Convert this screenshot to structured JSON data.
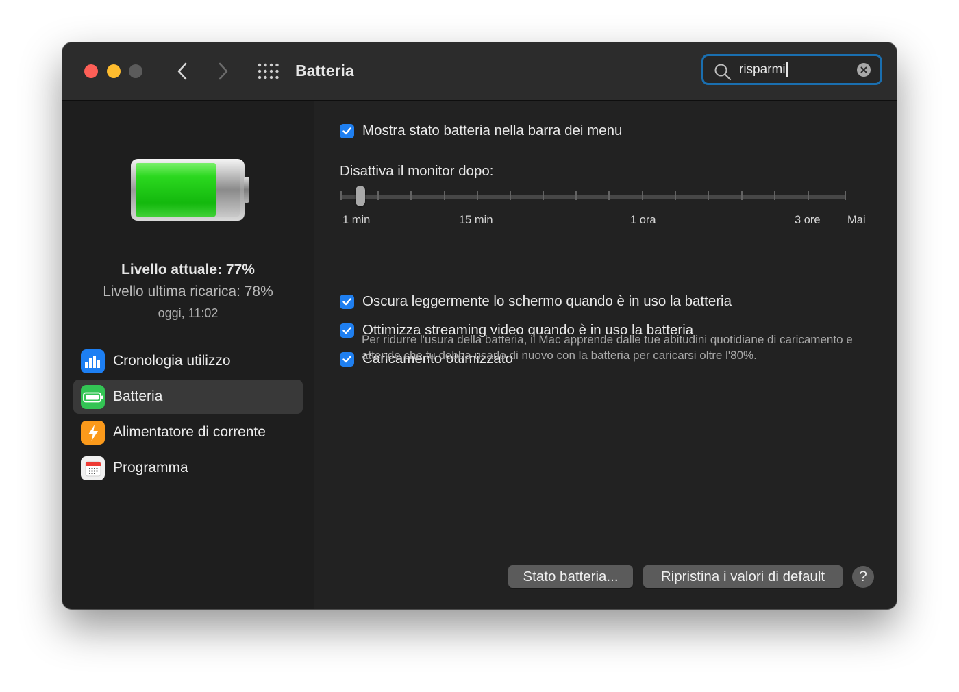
{
  "window": {
    "title": "Batteria"
  },
  "search": {
    "value": "risparmi"
  },
  "sidebar": {
    "level_now": "Livello attuale: 77%",
    "level_last": "Livello ultima ricarica: 78%",
    "level_time": "oggi, 11:02",
    "battery_level": 0.77,
    "items": [
      {
        "label": "Cronologia utilizzo",
        "icon": "bar-chart-icon",
        "active": false
      },
      {
        "label": "Batteria",
        "icon": "battery-icon",
        "active": true
      },
      {
        "label": "Alimentatore di corrente",
        "icon": "lightning-bolt-icon",
        "active": false
      },
      {
        "label": "Programma",
        "icon": "calendar-icon",
        "active": false
      }
    ]
  },
  "content": {
    "menubar_checkbox": {
      "label": "Mostra stato batteria nella barra dei menu",
      "checked": true
    },
    "slider": {
      "label": "Disattiva il monitor dopo:",
      "tick_labels": [
        "1 min",
        "15 min",
        "1 ora",
        "3 ore",
        "Mai"
      ],
      "value": "1 min"
    },
    "dim_checkbox": {
      "label": "Oscura leggermente lo schermo quando è in uso la batteria",
      "checked": true
    },
    "streaming_checkbox": {
      "label": "Ottimizza streaming video quando è in uso la batteria",
      "checked": true
    },
    "charging_checkbox": {
      "label": "Caricamento ottimizzato",
      "checked": true
    },
    "charging_description": "Per ridurre l'usura della batteria, il Mac apprende dalle tue abitudini quotidiane di caricamento e attende che tu debba usarlo di nuovo con la batteria per caricarsi oltre l'80%.",
    "buttons": {
      "status": "Stato batteria...",
      "reset": "Ripristina i valori di default",
      "help": "?"
    }
  },
  "colors": {
    "accent": "#1f7ff0",
    "battery_fill": "#22c51a",
    "search_focus": "#1a6fb0"
  }
}
